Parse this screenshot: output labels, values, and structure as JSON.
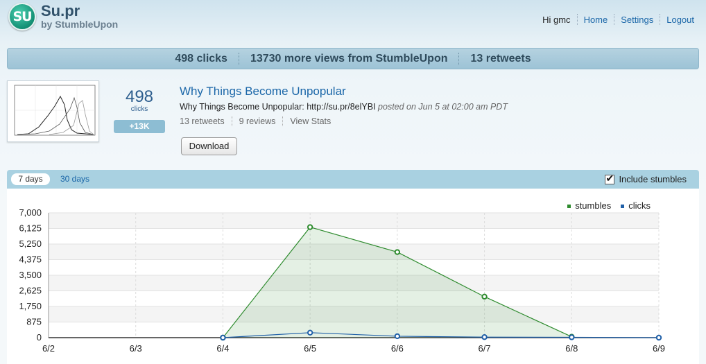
{
  "header": {
    "logo_text": "SU",
    "title": "Su.pr",
    "subtitle": "by StumbleUpon",
    "greeting": "Hi gmc",
    "nav": [
      "Home",
      "Settings",
      "Logout"
    ]
  },
  "stats": {
    "clicks": "498 clicks",
    "views": "13730 more views from StumbleUpon",
    "retweets": "13 retweets"
  },
  "story": {
    "click_count": "498",
    "click_label": "clicks",
    "badge": "+13K",
    "title": "Why Things Become Unpopular",
    "line_text": "Why Things Become Unpopular: http://su.pr/8elYBI",
    "line_meta": "posted on Jun 5 at 02:00 am PDT",
    "retweets_link": "13 retweets",
    "reviews_link": "9 reviews",
    "stats_link": "View Stats",
    "download_label": "Download"
  },
  "panel": {
    "tab_active": "7 days",
    "tab_other": "30 days",
    "include_label": "Include stumbles",
    "include_checked": true
  },
  "colors": {
    "stumbles": "#2e8b2e",
    "clicks": "#2060a8"
  },
  "chart_data": {
    "type": "area",
    "categories": [
      "6/2",
      "6/3",
      "6/4",
      "6/5",
      "6/6",
      "6/7",
      "6/8",
      "6/9"
    ],
    "series": [
      {
        "name": "stumbles",
        "values": [
          null,
          null,
          0,
          6200,
          4800,
          2300,
          50,
          null
        ]
      },
      {
        "name": "clicks",
        "values": [
          null,
          null,
          0,
          280,
          80,
          30,
          20,
          0
        ]
      }
    ],
    "y_ticks": [
      "7,000",
      "6,125",
      "5,250",
      "4,375",
      "3,500",
      "2,625",
      "1,750",
      "875",
      "0"
    ],
    "ylim": [
      0,
      7000
    ],
    "legend_position": "top-right",
    "grid": true
  }
}
